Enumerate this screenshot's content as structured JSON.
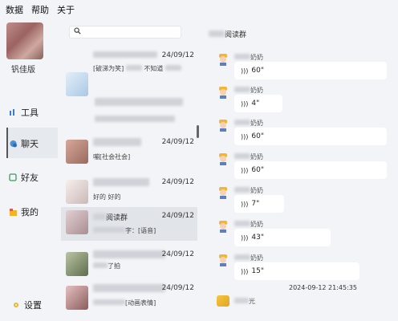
{
  "menu": {
    "items": [
      "数据",
      "帮助",
      "关于"
    ]
  },
  "user": {
    "name": "钒佳版"
  },
  "nav": {
    "tools": {
      "label": "工具",
      "icon": "tools-icon"
    },
    "chat": {
      "label": "聊天",
      "icon": "chat-icon"
    },
    "friends": {
      "label": "好友",
      "icon": "friends-icon"
    },
    "me": {
      "label": "我的",
      "icon": "me-icon"
    },
    "settings": {
      "label": "设置",
      "icon": "gear-icon"
    }
  },
  "chats": [
    {
      "name": "",
      "date": "24/09/12",
      "preview": "[破涕为笑]",
      "preview2": "不知道",
      "avatar_color": "#cfe3f3"
    },
    {
      "name": "",
      "date": "",
      "preview": "",
      "avatar_color": "#f2f4f7"
    },
    {
      "name": "",
      "date": "24/09/12",
      "preview": "嘣[社会社会]",
      "avatar_color": "#c18e84"
    },
    {
      "name": "",
      "date": "24/09/12",
      "preview": "好的 好的",
      "avatar_color": "#e5d8d6"
    },
    {
      "name": "阅读群",
      "date": "24/09/12",
      "preview": "字：[语音]",
      "avatar_color": "#d9c5c8"
    },
    {
      "name": "",
      "date": "24/09/12",
      "preview": "了拍",
      "avatar_color": "#7f8e6a"
    },
    {
      "name": "",
      "date": "24/09/12",
      "preview": "[动画表情]",
      "avatar_color": "#c99a9a"
    }
  ],
  "conversation": {
    "title": "阅读群",
    "messages": [
      {
        "sender": "奶奶",
        "duration": "60\""
      },
      {
        "sender": "奶奶",
        "duration": "4\""
      },
      {
        "sender": "奶奶",
        "duration": "60\""
      },
      {
        "sender": "奶奶",
        "duration": "60\""
      },
      {
        "sender": "奶奶",
        "duration": "7\""
      },
      {
        "sender": "奶奶",
        "duration": "43\""
      },
      {
        "sender": "奶奶",
        "duration": "15\""
      }
    ],
    "timestamp": "2024-09-12 21:45:35",
    "last_sender": "光"
  }
}
